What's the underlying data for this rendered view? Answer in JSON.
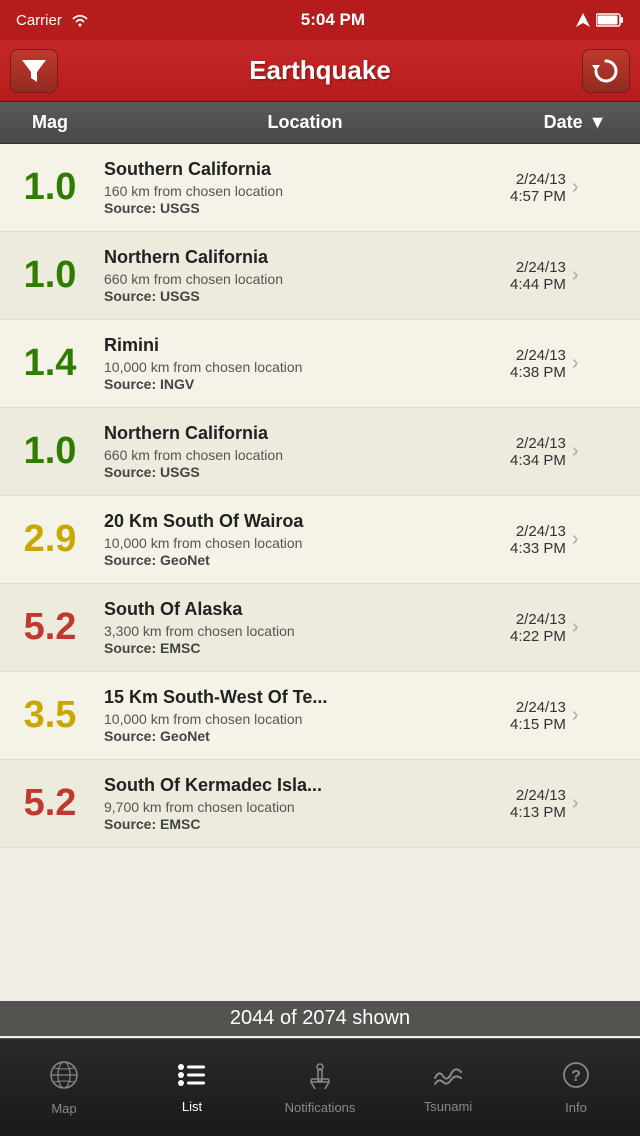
{
  "statusBar": {
    "carrier": "Carrier",
    "time": "5:04 PM"
  },
  "header": {
    "title": "Earthquake",
    "filterLabel": "Filter",
    "refreshLabel": "Refresh"
  },
  "columns": {
    "mag": "Mag",
    "location": "Location",
    "date": "Date"
  },
  "earthquakes": [
    {
      "mag": "1.0",
      "magClass": "mag-green",
      "name": "Southern California",
      "distance": "160 km from chosen location",
      "source": "Source: USGS",
      "date": "2/24/13",
      "time": "4:57 PM"
    },
    {
      "mag": "1.0",
      "magClass": "mag-green",
      "name": "Northern California",
      "distance": "660 km from chosen location",
      "source": "Source: USGS",
      "date": "2/24/13",
      "time": "4:44 PM"
    },
    {
      "mag": "1.4",
      "magClass": "mag-green",
      "name": "Rimini",
      "distance": "10,000 km from chosen location",
      "source": "Source: INGV",
      "date": "2/24/13",
      "time": "4:38 PM"
    },
    {
      "mag": "1.0",
      "magClass": "mag-green",
      "name": "Northern California",
      "distance": "660 km from chosen location",
      "source": "Source: USGS",
      "date": "2/24/13",
      "time": "4:34 PM"
    },
    {
      "mag": "2.9",
      "magClass": "mag-yellow",
      "name": "20 Km South Of Wairoa",
      "distance": "10,000 km from chosen location",
      "source": "Source: GeoNet",
      "date": "2/24/13",
      "time": "4:33 PM"
    },
    {
      "mag": "5.2",
      "magClass": "mag-red",
      "name": "South Of Alaska",
      "distance": "3,300 km from chosen location",
      "source": "Source: EMSC",
      "date": "2/24/13",
      "time": "4:22 PM"
    },
    {
      "mag": "3.5",
      "magClass": "mag-yellow",
      "name": "15 Km South-West Of Te...",
      "distance": "10,000 km from chosen location",
      "source": "Source: GeoNet",
      "date": "2/24/13",
      "time": "4:15 PM"
    },
    {
      "mag": "5.2",
      "magClass": "mag-red",
      "name": "South Of Kermadec Isla...",
      "distance": "9,700 km from chosen location",
      "source": "Source: EMSC",
      "date": "2/24/13",
      "time": "4:13 PM"
    }
  ],
  "countOverlay": "2044 of 2074 shown",
  "tabs": [
    {
      "id": "map",
      "label": "Map",
      "icon": "🌐",
      "active": false
    },
    {
      "id": "list",
      "label": "List",
      "icon": "list",
      "active": true
    },
    {
      "id": "notifications",
      "label": "Notifications",
      "icon": "⚙",
      "active": false
    },
    {
      "id": "tsunami",
      "label": "Tsunami",
      "icon": "tsunami",
      "active": false
    },
    {
      "id": "info",
      "label": "Info",
      "icon": "?",
      "active": false
    }
  ]
}
